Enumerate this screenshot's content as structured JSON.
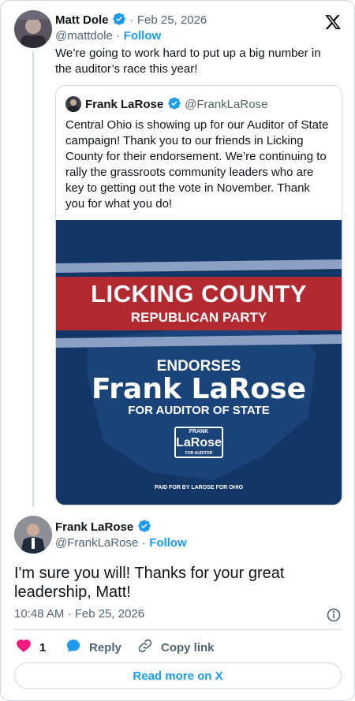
{
  "original_tweet": {
    "author_name": "Matt Dole",
    "handle": "@mattdole",
    "date": "Feb 25, 2026",
    "follow_label": "Follow",
    "text": "We’re going to work hard to put up a big number in the auditor’s race this year!"
  },
  "quoted_tweet": {
    "author_name": "Frank LaRose",
    "handle": "@FrankLaRose",
    "text": "Central Ohio is showing up for our Auditor of State campaign! Thank you to our friends in Licking County for their endorsement. We’re continuing to rally the grassroots community leaders who are key to getting out the vote in November. Thank you for what you do!",
    "image": {
      "line1": "LICKING COUNTY",
      "line2": "REPUBLICAN PARTY",
      "line3": "ENDORSES",
      "line4": "Frank LaRose",
      "line5": "FOR AUDITOR OF STATE",
      "logo_top": "FRANK",
      "logo_main": "LaRose",
      "logo_sub": "FOR AUDITOR",
      "paid_for": "PAID FOR BY LAROSE FOR OHIO"
    }
  },
  "reply_tweet": {
    "author_name": "Frank LaRose",
    "handle": "@FrankLaRose",
    "follow_label": "Follow",
    "text": "I'm sure you will! Thanks for your great leadership, Matt!",
    "timestamp": "10:48 AM · Feb 25, 2026"
  },
  "actions": {
    "like_count": "1",
    "reply_label": "Reply",
    "copy_link_label": "Copy link"
  },
  "read_more_label": "Read more on X",
  "separator": "·",
  "colors": {
    "accent": "#1d9bf0",
    "like": "#f91880",
    "border": "#cfd9de",
    "muted": "#536471",
    "banner_red": "#b22a30",
    "banner_blue": "#123766"
  },
  "icons": [
    "x-logo-icon",
    "verified-badge-icon",
    "info-icon",
    "heart-icon",
    "reply-bubble-icon",
    "link-icon"
  ]
}
